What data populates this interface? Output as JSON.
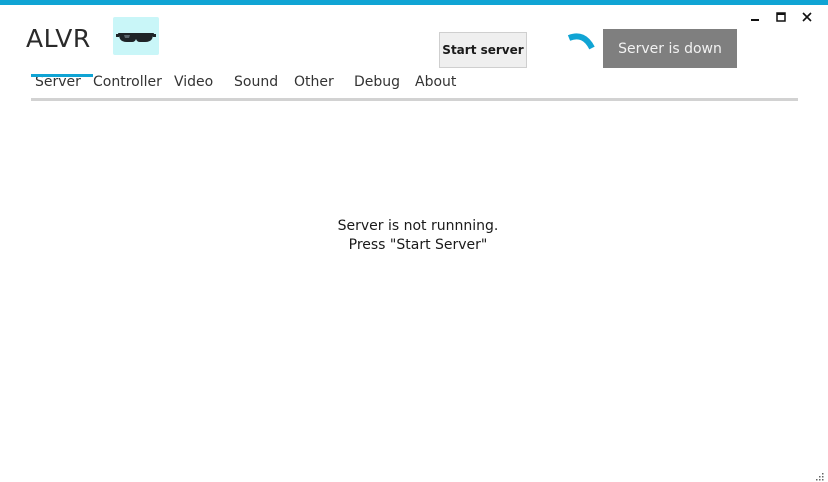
{
  "app": {
    "title": "ALVR",
    "logo_icon": "vr-headset-icon",
    "accent_color": "#10a4d4"
  },
  "window_controls": {
    "minimize_icon": "minimize-icon",
    "maximize_icon": "maximize-icon",
    "close_icon": "close-icon"
  },
  "header": {
    "start_button_label": "Start server",
    "status_text": "Server is down",
    "status_color": "#7f7f7f",
    "spinner_icon": "loading-spinner-icon"
  },
  "tabs": [
    {
      "label": "Server",
      "active": true
    },
    {
      "label": "Controller",
      "active": false
    },
    {
      "label": "Video",
      "active": false
    },
    {
      "label": "Sound",
      "active": false
    },
    {
      "label": "Other",
      "active": false
    },
    {
      "label": "Debug",
      "active": false
    },
    {
      "label": "About",
      "active": false
    }
  ],
  "main": {
    "message_line1": "Server is not runnning.",
    "message_line2": "Press \"Start Server\""
  }
}
